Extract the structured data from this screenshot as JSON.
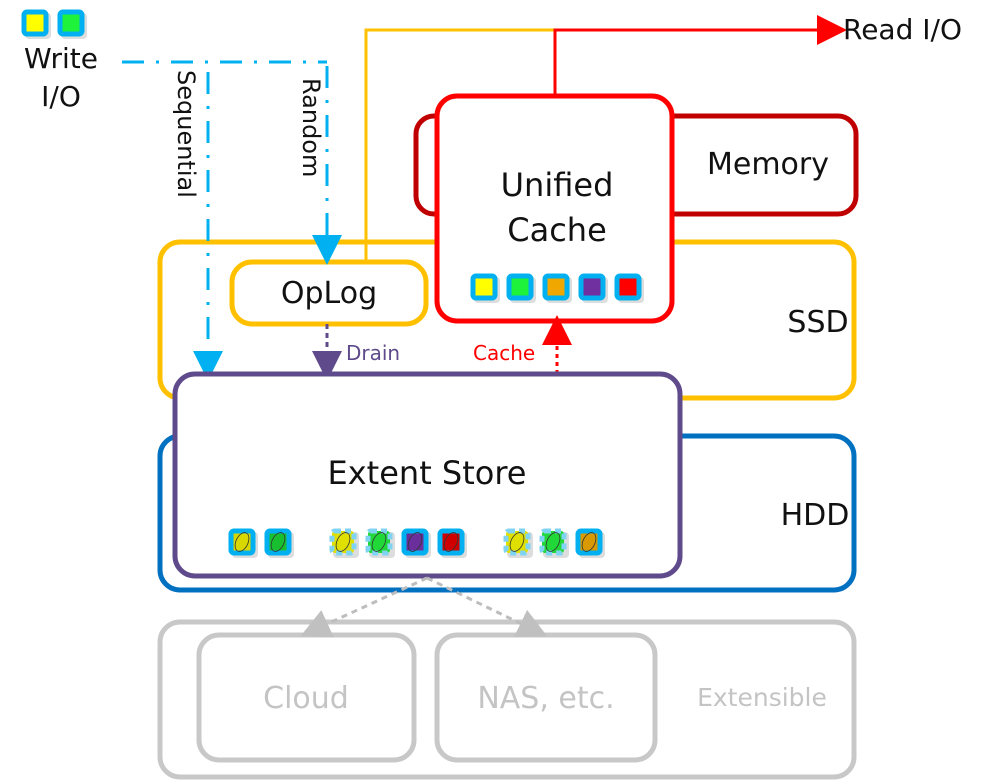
{
  "write_io": {
    "line1": "Write",
    "line2": "I/O",
    "blocks": [
      "#ffff00",
      "#1ef23a"
    ]
  },
  "read_io": {
    "label": "Read I/O"
  },
  "paths": {
    "sequential": "Sequential",
    "random": "Random",
    "drain": "Drain",
    "cache": "Cache"
  },
  "tiers": {
    "memory": {
      "label": "Memory",
      "color": "#c00000"
    },
    "ssd": {
      "label": "SSD",
      "color": "#ffc000"
    },
    "hdd": {
      "label": "HDD",
      "color": "#0070c0"
    },
    "extensible": {
      "label": "Extensible",
      "color": "#c8c8c8"
    }
  },
  "components": {
    "unified_cache": {
      "line1": "Unified",
      "line2": "Cache",
      "color": "#ff0000",
      "blocks": [
        "#ffff00",
        "#1ef23a",
        "#f0a800",
        "#7030a0",
        "#ff0000"
      ]
    },
    "oplog": {
      "label": "OpLog"
    },
    "extent_store": {
      "label": "Extent Store",
      "color": "#5f4b8b",
      "blocks": [
        {
          "color": "#d8d800",
          "style": "solid"
        },
        {
          "color": "#18c030",
          "style": "solid"
        },
        {
          "color": "#e0e000",
          "style": "dashed"
        },
        {
          "color": "#20d838",
          "style": "dashed"
        },
        {
          "color": "#6a2f9a",
          "style": "solid"
        },
        {
          "color": "#d00000",
          "style": "solid"
        },
        {
          "color": "#e0e000",
          "style": "dashed"
        },
        {
          "color": "#20d838",
          "style": "dashed"
        },
        {
          "color": "#d89a00",
          "style": "solid"
        }
      ]
    },
    "cloud": {
      "label": "Cloud"
    },
    "nas": {
      "label": "NAS, etc."
    }
  },
  "colors": {
    "write_path": "#00b0f0",
    "drain": "#5f4b8b",
    "read_path": "#ff0000",
    "oplog_read": "#ffc000"
  }
}
